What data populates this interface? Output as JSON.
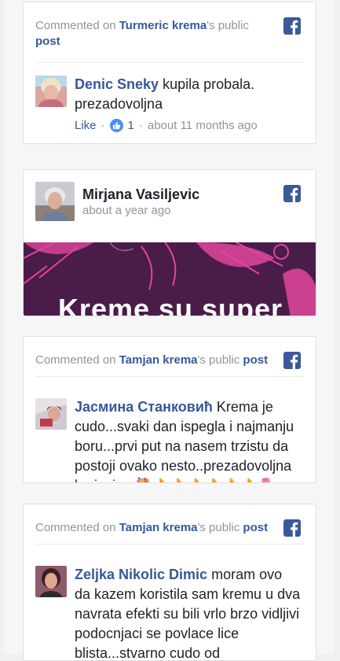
{
  "cards": [
    {
      "prefix": "Commented on ",
      "page": "Turmeric krema",
      "suffix": "'s public",
      "post": "post",
      "author": "Denic Sneky",
      "text": " kupila probala. prezadovoljna",
      "like": "Like",
      "dot": "·",
      "like_count": "1",
      "time": "about 11 months ago"
    },
    {
      "author": "Mirjana Vasiljevic",
      "time": "about a year ago",
      "banner_text": "Kreme su super"
    },
    {
      "prefix": "Commented on ",
      "page": "Tamjan krema",
      "suffix": "'s public ",
      "post": "post",
      "author": "Јасмина Станковић",
      "text": " Krema je cudo...svaki dan ispegla i najmanju boru...prvi put na nasem trzistu da postoji ovako nesto..prezadovoljna korisnica 💐👌👌👌👌👌👌🌷"
    },
    {
      "prefix": "Commented on ",
      "page": "Tamjan krema",
      "suffix": "'s public ",
      "post": "post",
      "author": "Zeljka Nikolic Dimic",
      "text": " moram ovo da kazem koristila sam kremu u dva navrata efekti su bili vrlo brzo vidljivi podocnjaci se povlace lice blista...stvarno cudo od"
    }
  ],
  "colors": {
    "link": "#365899",
    "muted": "#90949c",
    "banner": "#4a1c4a",
    "accent": "#e0459a"
  },
  "icons": [
    "facebook-icon",
    "like-thumb-icon"
  ]
}
